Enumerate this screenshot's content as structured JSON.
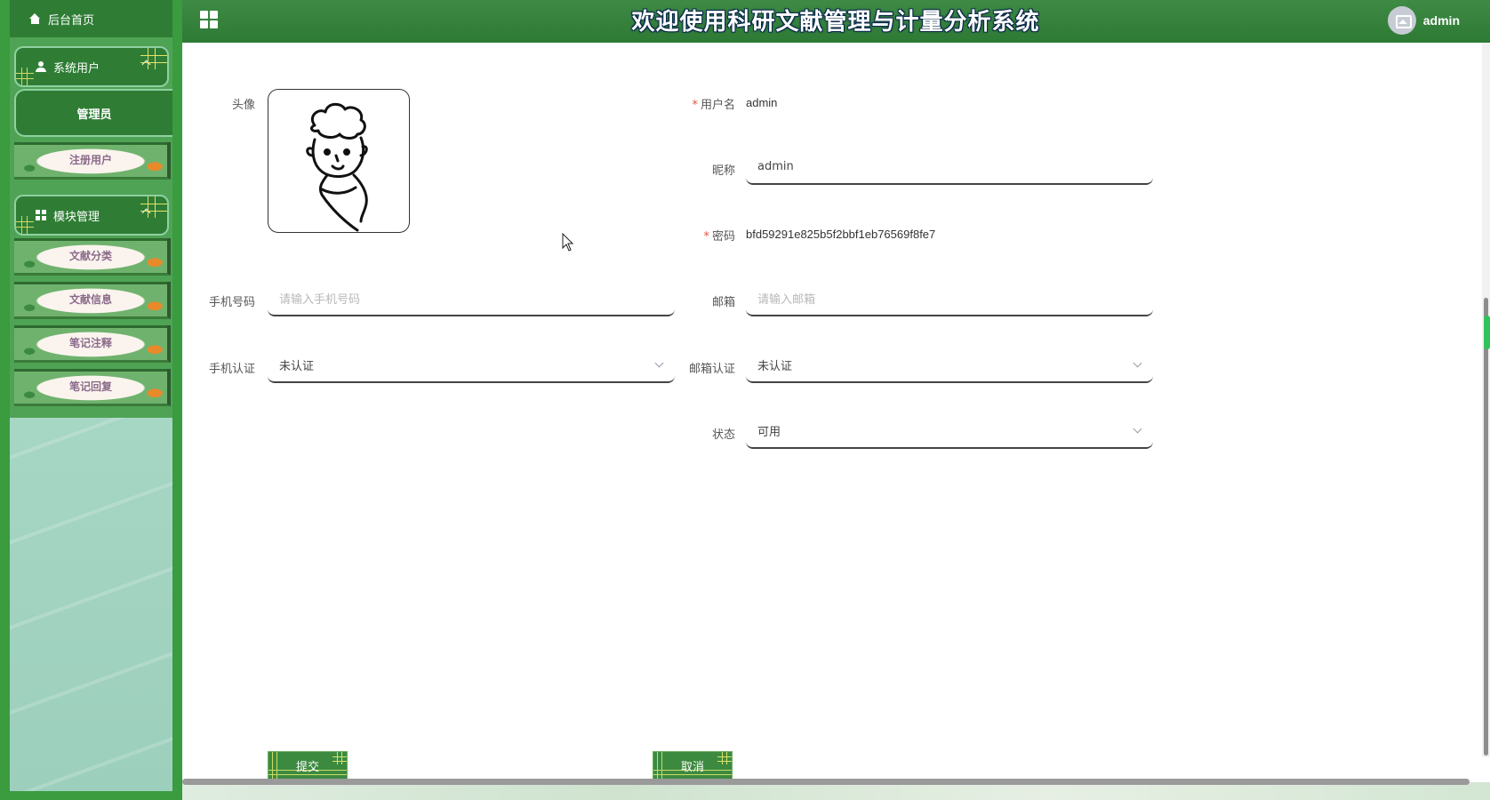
{
  "header": {
    "title": "欢迎使用科研文献管理与计量分析系统",
    "user": "admin"
  },
  "sidebar": {
    "home": "后台首页",
    "groups": [
      {
        "label": "系统用户",
        "items": [
          "管理员",
          "注册用户"
        ]
      },
      {
        "label": "模块管理",
        "items": [
          "文献分类",
          "文献信息",
          "笔记注释",
          "笔记回复"
        ]
      }
    ]
  },
  "form": {
    "avatar_label": "头像",
    "username_label": "用户名",
    "username_value": "admin",
    "nickname_label": "昵称",
    "nickname_value": "admin",
    "password_label": "密码",
    "password_value": "bfd59291e825b5f2bbf1eb76569f8fe7",
    "phone_label": "手机号码",
    "phone_placeholder": "请输入手机号码",
    "email_label": "邮箱",
    "email_placeholder": "请输入邮箱",
    "phone_verify_label": "手机认证",
    "phone_verify_value": "未认证",
    "email_verify_label": "邮箱认证",
    "email_verify_value": "未认证",
    "status_label": "状态",
    "status_value": "可用",
    "submit": "提交",
    "cancel": "取消"
  },
  "colors": {
    "header_green": "#2d7a35",
    "sidebar_green": "#3a9b3f",
    "required_star": "#e0543e"
  }
}
